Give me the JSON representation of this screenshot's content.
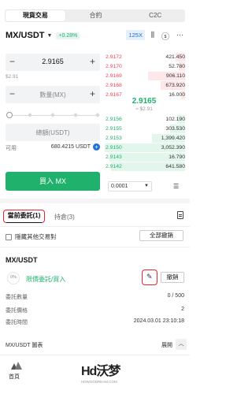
{
  "top_tabs": [
    "現貨交易",
    "合約",
    "C2C"
  ],
  "pair": {
    "name": "MX/USDT",
    "change": "+0.28%",
    "leverage": "125X"
  },
  "form": {
    "price": "2.9165",
    "price_usd": "$2.91",
    "amount_placeholder": "數量(MX)",
    "total_placeholder": "總額(USDT)",
    "available_label": "可用",
    "available_amount": "680.4215 USDT",
    "buy_button": "買入 MX",
    "slider_percent": 0
  },
  "orderbook": {
    "asks": [
      {
        "price": "2.9172",
        "qty": "421.450"
      },
      {
        "price": "2.9170",
        "qty": "52.780"
      },
      {
        "price": "2.9169",
        "qty": "906.110"
      },
      {
        "price": "2.9168",
        "qty": "673.920"
      },
      {
        "price": "2.9167",
        "qty": "16.000"
      }
    ],
    "mid_price": "2.9165",
    "mid_usd": "≈ $2.91",
    "bids": [
      {
        "price": "2.9156",
        "qty": "102.190"
      },
      {
        "price": "2.9155",
        "qty": "303.530"
      },
      {
        "price": "2.9153",
        "qty": "1,399.420"
      },
      {
        "price": "2.9150",
        "qty": "3,052.390"
      },
      {
        "price": "2.9143",
        "qty": "16.790"
      },
      {
        "price": "2.9142",
        "qty": "641.580"
      }
    ],
    "precision": "0.0001"
  },
  "orders": {
    "tab_active": "當前委託(1)",
    "tab_other": "持倉(3)",
    "hide_others": "隱藏其他交易對",
    "cancel_all": "全部撤銷",
    "item": {
      "pair": "MX/USDT",
      "progress": "0%",
      "type": "限價委託/買入",
      "cancel": "撤銷",
      "qty_label": "委託數量",
      "qty_value": "0 / 500",
      "price_label": "委託價格",
      "price_value": "2",
      "time_label": "委託時間",
      "time_value": "2024.03.01 23:10:18"
    }
  },
  "chart_bar": {
    "label": "MX/USDT 圖表",
    "expand": "展開"
  },
  "bottom_nav": {
    "home": "首頁"
  },
  "watermark": {
    "main": "Hd沃梦",
    "sub": "HDWOODREAM.COM"
  }
}
